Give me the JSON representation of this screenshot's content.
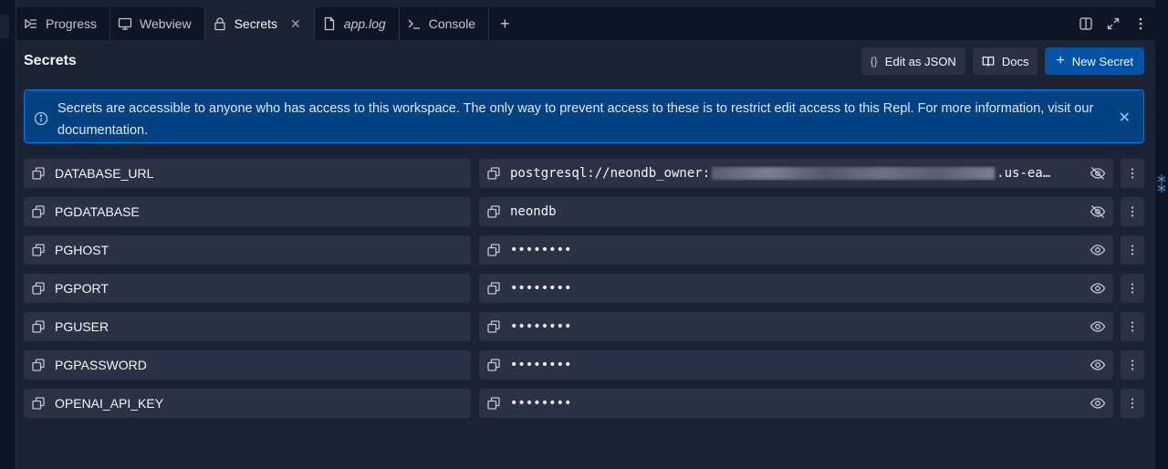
{
  "tabs": [
    {
      "label": "Progress",
      "icon": "progress-icon",
      "active": false,
      "italic": false
    },
    {
      "label": "Webview",
      "icon": "monitor-icon",
      "active": false,
      "italic": false
    },
    {
      "label": "Secrets",
      "icon": "lock-icon",
      "active": true,
      "italic": false
    },
    {
      "label": "app.log",
      "icon": "file-icon",
      "active": false,
      "italic": true
    },
    {
      "label": "Console",
      "icon": "terminal-icon",
      "active": false,
      "italic": false
    }
  ],
  "header": {
    "title": "Secrets",
    "edit_json_label": "Edit as JSON",
    "edit_json_icon": "{}",
    "docs_label": "Docs",
    "new_secret_label": "New Secret"
  },
  "banner": {
    "text": "Secrets are accessible to anyone who has access to this workspace. The only way to prevent access to these is to restrict edit access to this Repl. For more information, visit our documentation."
  },
  "secrets": [
    {
      "key": "DATABASE_URL",
      "value_prefix": "postgresql://neondb_owner:",
      "value_suffix": ".us-ea…",
      "redacted": true,
      "visible": true
    },
    {
      "key": "PGDATABASE",
      "value_prefix": "neondb",
      "value_suffix": "",
      "redacted": false,
      "visible": true
    },
    {
      "key": "PGHOST",
      "value_prefix": "••••••••",
      "value_suffix": "",
      "redacted": false,
      "visible": false
    },
    {
      "key": "PGPORT",
      "value_prefix": "••••••••",
      "value_suffix": "",
      "redacted": false,
      "visible": false
    },
    {
      "key": "PGUSER",
      "value_prefix": "••••••••",
      "value_suffix": "",
      "redacted": false,
      "visible": false
    },
    {
      "key": "PGPASSWORD",
      "value_prefix": "••••••••",
      "value_suffix": "",
      "redacted": false,
      "visible": false
    },
    {
      "key": "OPENAI_API_KEY",
      "value_prefix": "••••••••",
      "value_suffix": "",
      "redacted": false,
      "visible": false
    }
  ],
  "colors": {
    "background": "#0e1525",
    "panel": "#1c2333",
    "field": "#2b3245",
    "accent": "#0053a6",
    "banner": "#004182"
  }
}
